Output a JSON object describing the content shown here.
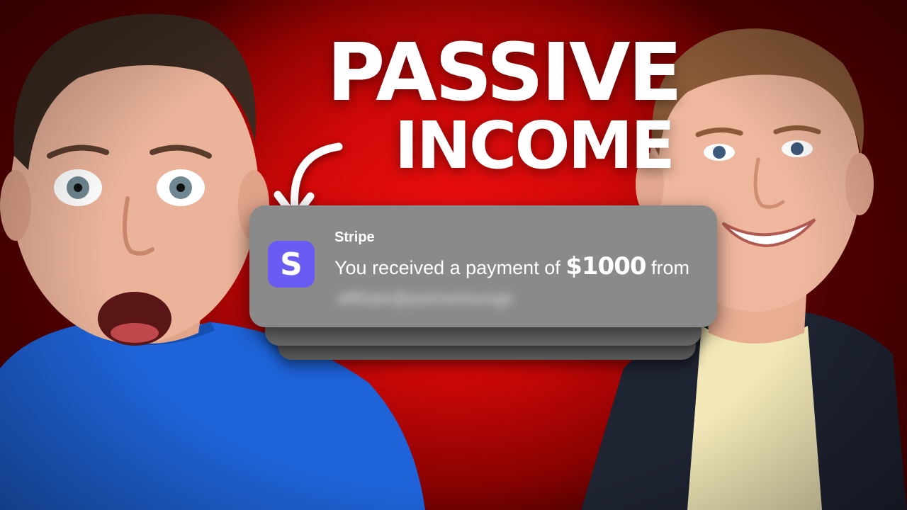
{
  "headline": {
    "line1": "PASSIVE",
    "line2": "INCOME"
  },
  "notification": {
    "app_name": "Stripe",
    "icon_letter": "S",
    "message_prefix": "You received a payment of ",
    "amount": "$1000",
    "message_suffix": " from",
    "blurred_sender": "affiliate@partnerlounge"
  },
  "colors": {
    "background": "#d00808",
    "stripe_purple": "#6a5cf2",
    "notification_gray": "#8a8a8a",
    "shirt_blue": "#1e63d8",
    "tee_cream": "#f2e8b8",
    "blazer_navy": "#1f2433"
  }
}
